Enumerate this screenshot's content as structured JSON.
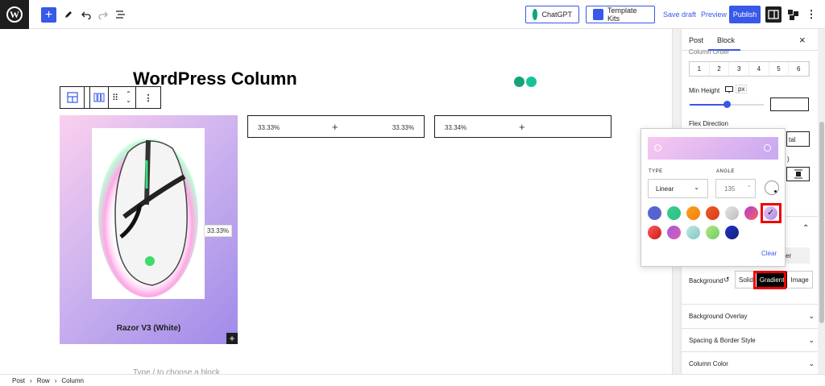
{
  "topbar": {
    "chatgpt_label": "ChatGPT",
    "template_kits_label": "Template Kits",
    "save_draft": "Save draft",
    "preview": "Preview",
    "publish": "Publish",
    "add_symbol": "+"
  },
  "editor": {
    "title": "WordPress Column",
    "column1_product": "Razor V3 (White)",
    "column1_width_tag": "33.33%",
    "column2_left": "33.33%",
    "column2_right": "33.33%",
    "column3_left": "33.34%",
    "plus": "+",
    "placeholder": "Type / to choose a block"
  },
  "sidebar": {
    "tab_post": "Post",
    "tab_block": "Block",
    "close": "×",
    "column_order_label": "Column Order",
    "order_options": [
      "1",
      "2",
      "3",
      "4",
      "5",
      "6"
    ],
    "min_height_label": "Min Height",
    "min_height_unit": "px",
    "min_height_value_fraction": 0.5,
    "flex_direction_label": "Flex Direction",
    "flex_partial_text": "tal",
    "flex_partial_paren": ")",
    "hover_partial": "er",
    "background_label": "Background",
    "bg_solid": "Solid",
    "bg_gradient": "Gradient",
    "bg_image": "Image",
    "sections": [
      "Background Overlay",
      "Spacing & Border Style",
      "Column Color"
    ]
  },
  "popover": {
    "type_label": "TYPE",
    "angle_label": "ANGLE",
    "type_value": "Linear",
    "angle_value": "135",
    "angle_unit": "°",
    "clear": "Clear",
    "gradient_start": "#f7c8f0",
    "gradient_end": "#c8a8f0",
    "swatches": [
      {
        "name": "blue-purple",
        "from": "#4e6cd9",
        "to": "#5e5acc"
      },
      {
        "name": "green",
        "from": "#3ccf8f",
        "to": "#2bbd83"
      },
      {
        "name": "orange",
        "from": "#fba21c",
        "to": "#f57c0f"
      },
      {
        "name": "red-orange",
        "from": "#ef5a27",
        "to": "#d93b1b"
      },
      {
        "name": "grey",
        "from": "#e4e4e4",
        "to": "#bcbcbc"
      },
      {
        "name": "magenta-orange",
        "from": "#b23bd6",
        "to": "#f9635b"
      },
      {
        "name": "lavender-selected",
        "from": "#f0c6f0",
        "to": "#a58ae9"
      },
      {
        "name": "red",
        "from": "#ff5a5a",
        "to": "#cc1a1a"
      },
      {
        "name": "purple-pink",
        "from": "#9e5ee5",
        "to": "#e05aaa"
      },
      {
        "name": "aqua",
        "from": "#c3e8e0",
        "to": "#7cc9c4"
      },
      {
        "name": "lime",
        "from": "#b6e77a",
        "to": "#6fcd6e"
      },
      {
        "name": "navy",
        "from": "#2131c7",
        "to": "#152079"
      }
    ]
  },
  "statusbar": {
    "crumbs": [
      "Post",
      "Row",
      "Column"
    ],
    "separator": "›"
  },
  "colors": {
    "accent": "#3858e9",
    "highlight": "#ee0000"
  }
}
